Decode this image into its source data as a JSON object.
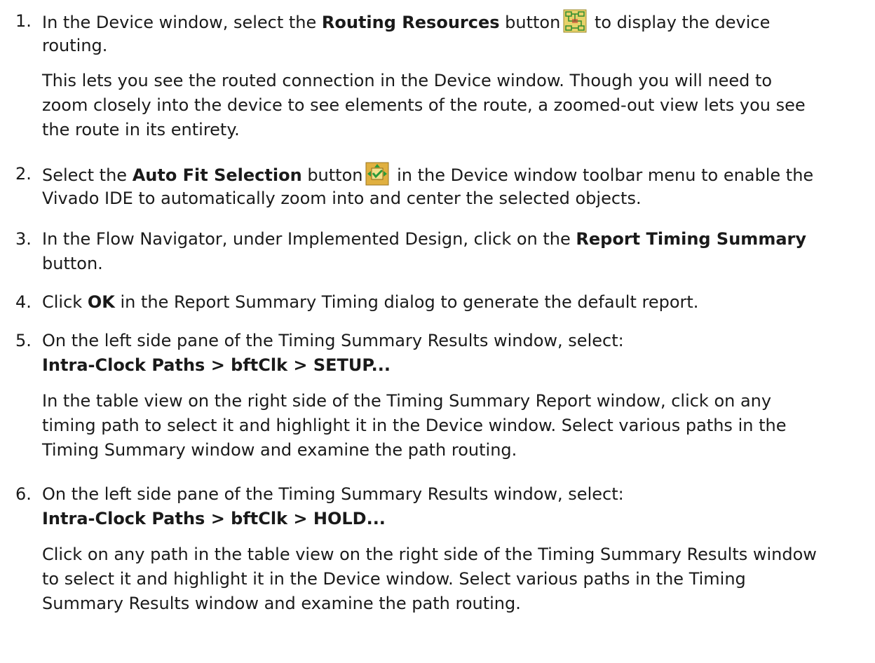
{
  "steps": [
    {
      "number": "1.",
      "lines": [
        {
          "a": "In the Device window, select the ",
          "b": "Routing Resources",
          "c": " button",
          "d": " to display the device"
        },
        {
          "a": "routing."
        }
      ],
      "icon": "routing-resources-icon",
      "paragraph": [
        "This lets you see the routed connection in the Device window. Though you will need to",
        "zoom closely into the device to see elements of the route, a zoomed-out view lets you see",
        "the route in its entirety."
      ]
    },
    {
      "number": "2.",
      "lines": [
        {
          "a": "Select the ",
          "b": "Auto Fit Selection",
          "c": " button",
          "d": " in the Device window toolbar menu to enable the"
        },
        {
          "a": "Vivado IDE to automatically zoom into and center the selected objects."
        }
      ],
      "icon": "auto-fit-selection-icon"
    },
    {
      "number": "3.",
      "lines": [
        {
          "a": "In the Flow Navigator, under Implemented Design, click on the ",
          "b": "Report Timing Summary"
        },
        {
          "a": "button."
        }
      ]
    },
    {
      "number": "4.",
      "lines": [
        {
          "a": "Click ",
          "b": "OK",
          "c": " in the Report Summary Timing dialog to generate the default report."
        }
      ]
    },
    {
      "number": "5.",
      "lines": [
        {
          "a": "On the left side pane of the Timing Summary Results window, select:"
        },
        {
          "b": "Intra-Clock Paths > bftClk > SETUP..."
        }
      ],
      "paragraph": [
        "In the table view on the right side of the Timing Summary Report window, click on any",
        "timing path to select it and highlight it in the Device window. Select various paths in the",
        "Timing Summary window and examine the path routing."
      ]
    },
    {
      "number": "6.",
      "lines": [
        {
          "a": "On the left side pane of the Timing Summary Results window, select:"
        },
        {
          "b": "Intra-Clock Paths > bftClk > HOLD..."
        }
      ],
      "paragraph": [
        "Click on any path in the table view on the right side of the Timing Summary Results window",
        "to select it and highlight it in the Device window. Select various paths in the Timing",
        "Summary Results window and examine the path routing."
      ]
    }
  ],
  "colors": {
    "text": "#1a1a1a",
    "routing_icon_bg": "#e8d26a",
    "routing_icon_lines": "#2e8b2e",
    "autofit_icon_bg": "#e0b040",
    "autofit_icon_arrow": "#2a9a3a"
  }
}
